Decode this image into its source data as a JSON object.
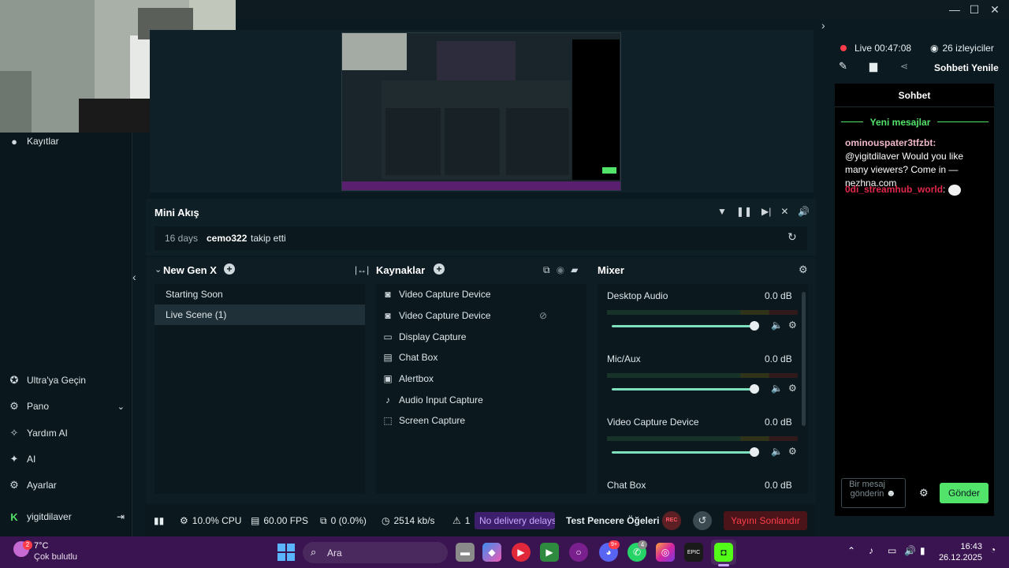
{
  "sidebar": {
    "items": [
      {
        "label": "Kayıtlar",
        "icon": "record-icon"
      },
      {
        "label": "Ultra'ya Geçin",
        "icon": "ultra-icon"
      },
      {
        "label": "Pano",
        "icon": "dashboard-icon"
      },
      {
        "label": "Yardım AI",
        "icon": "help-ai-icon"
      },
      {
        "label": "AI",
        "icon": "ai-sparkle-icon"
      },
      {
        "label": "Ayarlar",
        "icon": "gear-icon"
      }
    ],
    "user": "yigitdilaver"
  },
  "mini_akis": {
    "title": "Mini Akış",
    "event_time": "16 days",
    "event_user": "cemo322",
    "event_action": "takip etti"
  },
  "scenes": {
    "title": "New Gen X",
    "items": [
      "Starting Soon",
      "Live Scene (1)"
    ],
    "active_index": 1
  },
  "sources": {
    "title": "Kaynaklar",
    "items": [
      {
        "label": "Video Capture Device",
        "icon": "camera-icon"
      },
      {
        "label": "Video Capture Device",
        "icon": "camera-icon"
      },
      {
        "label": "Display Capture",
        "icon": "monitor-icon"
      },
      {
        "label": "Chat Box",
        "icon": "chat-icon"
      },
      {
        "label": "Alertbox",
        "icon": "bell-icon"
      },
      {
        "label": "Audio Input Capture",
        "icon": "mic-icon"
      },
      {
        "label": "Screen Capture",
        "icon": "screen-capture-icon"
      }
    ]
  },
  "mixer": {
    "title": "Mixer",
    "channels": [
      {
        "name": "Desktop Audio",
        "db": "0.0 dB",
        "level": 1.0
      },
      {
        "name": "Mic/Aux",
        "db": "0.0 dB",
        "level": 1.0
      },
      {
        "name": "Video Capture Device",
        "db": "0.0 dB",
        "level": 1.0
      },
      {
        "name": "Chat Box",
        "db": "0.0 dB",
        "level": 1.0
      }
    ]
  },
  "status": {
    "cpu": "10.0% CPU",
    "fps": "60.00 FPS",
    "dropped": "0 (0.0%)",
    "bitrate": "2514 kb/s",
    "alerts": "1",
    "delivery": "No delivery delays",
    "test_elements": "Test Pencere Öğeleri",
    "rec": "REC",
    "end_stream": "Yayını Sonlandır"
  },
  "chat": {
    "live": "Live 00:47:08",
    "viewers": "26 izleyiciler",
    "refresh": "Sohbeti Yenile",
    "title": "Sohbet",
    "new_messages": "Yeni mesajlar",
    "messages": [
      {
        "user": "ominouspater3tfzbt:",
        "text": "@yigitdilaver Would you like many viewers? Come in — nezhna.com",
        "color": "#f0b8c8"
      },
      {
        "user": "0di_streamhub_world",
        "text": ":",
        "color": "#e0284a"
      }
    ],
    "input_placeholder": "Bir mesaj gönderin",
    "send": "Gönder"
  },
  "taskbar": {
    "weather_temp": "7°C",
    "weather_desc": "Çok bulutlu",
    "weather_badge": "2",
    "search": "Ara",
    "time": "16:43",
    "date": "26.12.2025",
    "discord_badge": "9+",
    "whatsapp_badge": "4"
  },
  "colors": {
    "accent_green": "#7fe0c0",
    "send_green": "#52e36a",
    "end_red": "#ff3d4a",
    "delivery_purple": "#3d1f6e"
  }
}
